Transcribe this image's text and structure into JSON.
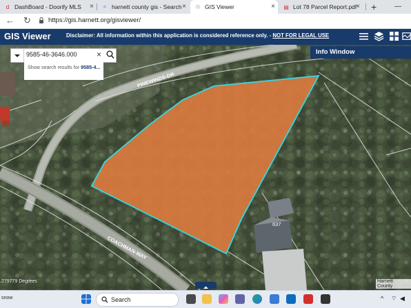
{
  "browser": {
    "tabs": [
      {
        "title": "DashBoard - Doorify MLS",
        "icon": "doorify-icon",
        "icon_glyph": "d",
        "icon_color": "#c62828"
      },
      {
        "title": "harnett county gis - Search",
        "icon": "search-icon",
        "icon_glyph": "⌕",
        "icon_color": "#3c6fd6"
      },
      {
        "title": "GIS Viewer",
        "icon": "gis-globe-icon",
        "icon_glyph": "☉",
        "icon_color": "#2e7d32"
      },
      {
        "title": "Lot 78 Parcel Report.pdf",
        "icon": "pdf-icon",
        "icon_glyph": "▤",
        "icon_color": "#d32f2f"
      }
    ],
    "active_tab": 2,
    "new_tab_label": "+",
    "url": "https://gis.harnett.org/gisviewer/"
  },
  "gis_header": {
    "title": "GIS Viewer",
    "disclaimer": "Disclaimer: All information within this application is considered reference only. -",
    "disclaimer_link": "NOT FOR LEGAL USE",
    "accent": "#183b6b"
  },
  "search": {
    "value": "9585-46-3646.000",
    "suggestion_prefix": "Show search results for",
    "suggestion_term": "9585-4..."
  },
  "info_window": {
    "label": "Info Window"
  },
  "map": {
    "road_labels": [
      "PINEWINDS-DR",
      "COACHMAN-WAY"
    ],
    "house_number": "637",
    "scale_text": ".279779 Degrees",
    "credit": "Harnett County",
    "parcel_fill": "#d9793e",
    "parcel_outline": "#3fd0d6"
  },
  "taskbar": {
    "left_text": "snow",
    "search_label": "Search"
  }
}
